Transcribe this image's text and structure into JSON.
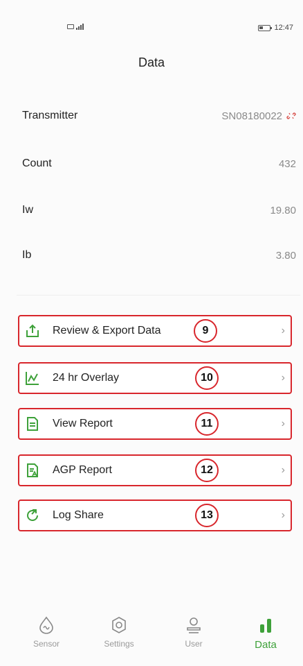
{
  "status_bar": {
    "time": "12:47"
  },
  "page_title": "Data",
  "info": {
    "transmitter": {
      "label": "Transmitter",
      "value": "SN08180022"
    },
    "count": {
      "label": "Count",
      "value": "432"
    },
    "iw": {
      "label": "Iw",
      "value": "19.80"
    },
    "ib": {
      "label": "Ib",
      "value": "3.80"
    }
  },
  "menu": [
    {
      "label": "Review & Export Data",
      "icon": "upload-icon",
      "badge": "9"
    },
    {
      "label": "24 hr Overlay",
      "icon": "overlay-chart-icon",
      "badge": "10"
    },
    {
      "label": "View Report",
      "icon": "report-icon",
      "badge": "11"
    },
    {
      "label": "AGP Report",
      "icon": "agp-report-icon",
      "badge": "12"
    },
    {
      "label": "Log Share",
      "icon": "share-icon",
      "badge": "13"
    }
  ],
  "nav": [
    {
      "label": "Sensor",
      "icon": "sensor-icon",
      "active": false
    },
    {
      "label": "Settings",
      "icon": "settings-icon",
      "active": false
    },
    {
      "label": "User",
      "icon": "user-icon",
      "active": false
    },
    {
      "label": "Data",
      "icon": "data-icon",
      "active": true
    }
  ],
  "colors": {
    "accent_green": "#3ea13a",
    "highlight_red": "#d8262c"
  }
}
